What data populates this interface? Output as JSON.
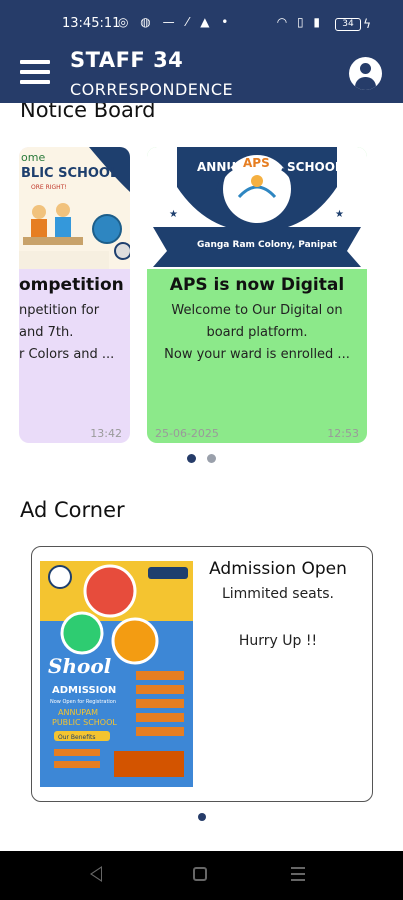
{
  "status_bar": {
    "time": "13:45:11",
    "battery": "34"
  },
  "header": {
    "title": "STAFF 34",
    "subtitle": "CORRESPONDENCE"
  },
  "notice_board": {
    "title": "Notice Board",
    "cards": [
      {
        "heading": "ompetition",
        "lines": [
          "npetition for",
          "and 7th.",
          "r Colors and ..."
        ],
        "date": "",
        "time": "13:42",
        "background": "#eadcf9",
        "image_text": [
          "ome",
          "BLIC SCHOOL",
          "ORE RIGHT!"
        ]
      },
      {
        "heading": "APS is now Digital",
        "lines": [
          "Welcome to Our Digital on",
          "board platform.",
          "Now your ward is enrolled ..."
        ],
        "date": "25-06-2025",
        "time": "12:53",
        "background": "#8ce98a",
        "image_text": [
          "ANNUM",
          "SCHOOL",
          "APS",
          "Ganga Ram Colony, Panipat"
        ]
      }
    ],
    "carousel_active_index": 0,
    "carousel_count": 2
  },
  "ad_corner": {
    "title": "Ad Corner",
    "ad": {
      "heading": "Admission Open",
      "line1": "Limmited seats.",
      "line2": "Hurry Up !!",
      "poster_text": [
        "Shool",
        "ADMISSION",
        "Now Open for Registration",
        "ANNUPAM",
        "PUBLIC SCHOOL",
        "Our Benefits"
      ]
    },
    "carousel_count": 1
  },
  "colors": {
    "header": "#263c69",
    "card_purple": "#eadcf9",
    "card_green": "#8ce98a",
    "dot_active": "#263c69",
    "dot_inactive": "#9aa0ab"
  }
}
